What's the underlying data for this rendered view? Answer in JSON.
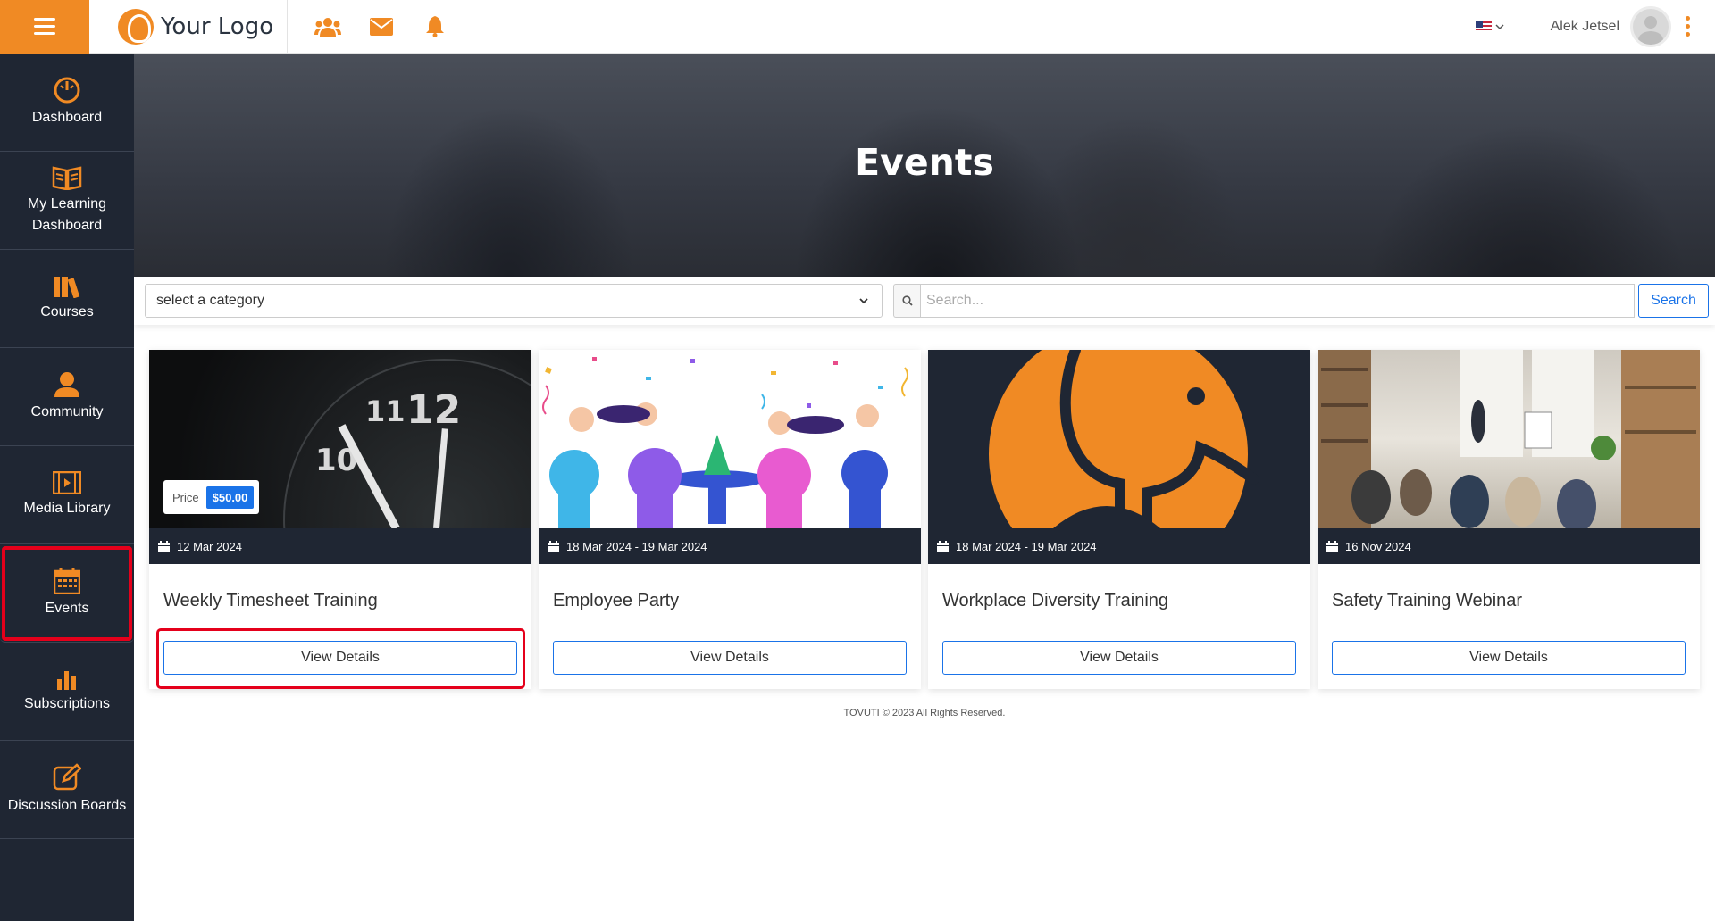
{
  "header": {
    "logo_text": "Your Logo",
    "user_name": "Alek Jetsel",
    "language": "en-US",
    "icons": [
      "users-icon",
      "mail-icon",
      "bell-icon"
    ],
    "accent_color": "#f08a24"
  },
  "sidebar": {
    "items": [
      {
        "label": "Dashboard",
        "icon": "speedometer-icon"
      },
      {
        "label": "My Learning Dashboard",
        "icon": "book-icon"
      },
      {
        "label": "Courses",
        "icon": "books-icon"
      },
      {
        "label": "Community",
        "icon": "person-icon"
      },
      {
        "label": "Media Library",
        "icon": "film-icon"
      },
      {
        "label": "Events",
        "icon": "calendar-icon",
        "active": true
      },
      {
        "label": "Subscriptions",
        "icon": "bar-chart-icon"
      },
      {
        "label": "Discussion Boards",
        "icon": "edit-icon"
      }
    ]
  },
  "hero": {
    "title": "Events"
  },
  "filters": {
    "category_value": "select a category",
    "search_placeholder": "Search...",
    "search_button": "Search"
  },
  "events": [
    {
      "title": "Weekly Timesheet Training",
      "date": "12 Mar 2024",
      "price_label": "Price",
      "price": "$50.00",
      "button": "View Details",
      "image": "clock"
    },
    {
      "title": "Employee Party",
      "date": "18 Mar 2024 - 19 Mar 2024",
      "button": "View Details",
      "image": "party"
    },
    {
      "title": "Workplace Diversity Training",
      "date": "18 Mar 2024 - 19 Mar 2024",
      "button": "View Details",
      "image": "elephant-logo"
    },
    {
      "title": "Safety Training Webinar",
      "date": "16 Nov 2024",
      "button": "View Details",
      "image": "classroom"
    }
  ],
  "footer": {
    "text": "TOVUTI © 2023 All Rights Reserved."
  }
}
